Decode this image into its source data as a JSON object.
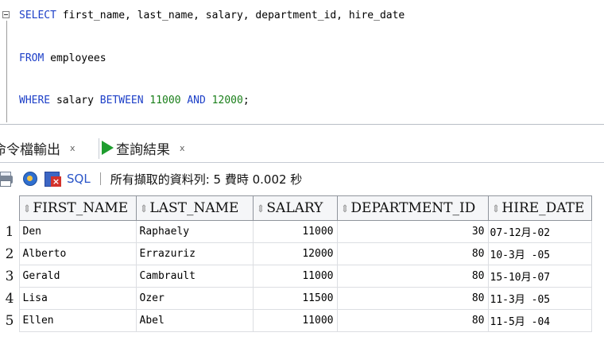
{
  "editor": {
    "line1": {
      "kw": "SELECT",
      "rest": " first_name, last_name, salary, department_id, hire_date"
    },
    "line2": {
      "kw": "FROM",
      "rest": " employees"
    },
    "line3": {
      "kw1": "WHERE",
      "mid1": " salary ",
      "kw2": "BETWEEN",
      "num1": " 11000 ",
      "kw3": "AND",
      "num2": " 12000",
      "end": ";"
    }
  },
  "tabs": [
    {
      "label": "命令檔輸出",
      "close": "x"
    },
    {
      "label": "查詢結果",
      "close": "x",
      "icon": "play-icon"
    }
  ],
  "toolbar": {
    "icons": [
      "printer-icon",
      "refresh-icon",
      "export-icon"
    ],
    "sql_label": "SQL",
    "separator": "|",
    "status": "所有擷取的資料列: 5 費時 0.002 秒"
  },
  "results": {
    "columns": [
      "FIRST_NAME",
      "LAST_NAME",
      "SALARY",
      "DEPARTMENT_ID",
      "HIRE_DATE"
    ],
    "sort_glyph": "⇕",
    "rows": [
      {
        "n": "1",
        "first_name": "Den",
        "last_name": "Raphaely",
        "salary": "11000",
        "department_id": "30",
        "hire_date": "07-12月-02"
      },
      {
        "n": "2",
        "first_name": "Alberto",
        "last_name": "Errazuriz",
        "salary": "12000",
        "department_id": "80",
        "hire_date": "10-3月 -05"
      },
      {
        "n": "3",
        "first_name": "Gerald",
        "last_name": "Cambrault",
        "salary": "11000",
        "department_id": "80",
        "hire_date": "15-10月-07"
      },
      {
        "n": "4",
        "first_name": "Lisa",
        "last_name": "Ozer",
        "salary": "11500",
        "department_id": "80",
        "hire_date": "11-3月 -05"
      },
      {
        "n": "5",
        "first_name": "Ellen",
        "last_name": "Abel",
        "salary": "11000",
        "department_id": "80",
        "hire_date": "11-5月 -04"
      }
    ]
  },
  "colors": {
    "keyword": "#1e40c8",
    "number": "#1a7f1a",
    "run": "#1e9d2e",
    "link": "#2a55c8"
  }
}
